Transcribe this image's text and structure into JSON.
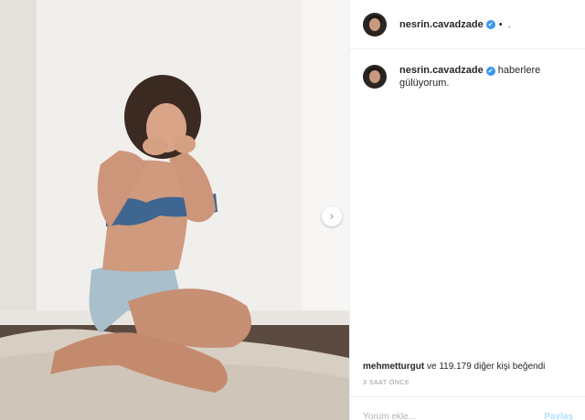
{
  "post": {
    "username": "nesrin.cavadzade",
    "verified_glyph": "✔",
    "header_separator": "•",
    "header_follow": ".",
    "caption_username": "nesrin.cavadzade",
    "caption_text": "haberlere gülüyorum.",
    "likes_user": "mehmetturgut",
    "likes_rest": "ve 119.179 diğer kişi beğendi",
    "time": "3 SAAT ÖNCE",
    "comment_placeholder": "Yorum ekle...",
    "share_label": "Paylaş"
  },
  "icons": {
    "next": "chevron-right-icon",
    "verified": "verified-badge-icon"
  },
  "colors": {
    "link_blue": "#3897f0",
    "share_disabled": "#b2dffc",
    "border": "#efefef",
    "muted": "#999999"
  }
}
